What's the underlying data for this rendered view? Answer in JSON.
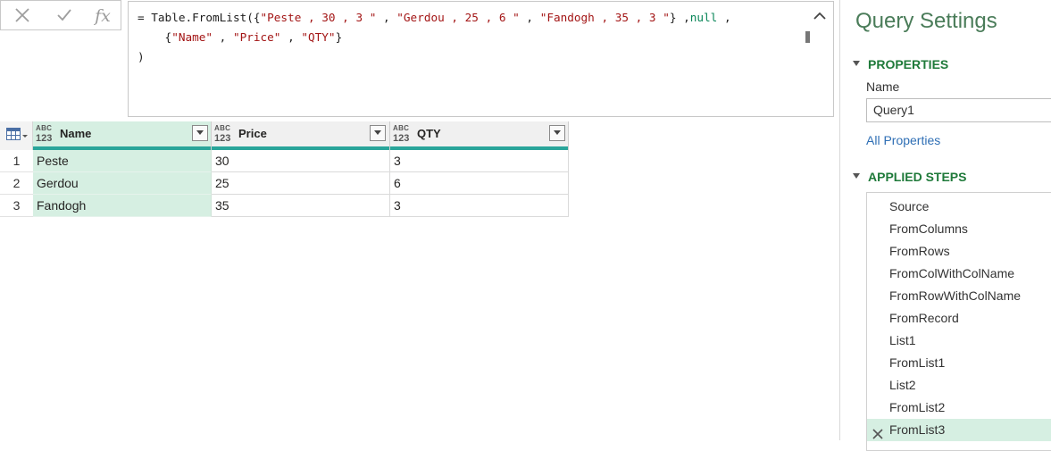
{
  "formula_bar": {
    "line1_prefix": "= Table.FromList({",
    "line1_str1": "\"Peste , 30 , 3 \"",
    "line1_comma1": " , ",
    "line1_str2": "\"Gerdou , 25 , 6 \"",
    "line1_comma2": " , ",
    "line1_str3": "\"Fandogh , 35 , 3 \"",
    "line1_close": "} ,",
    "line1_kw": "null",
    "line1_end": " ,",
    "line2_indent": "    {",
    "line2_str1": "\"Name\"",
    "line2_c1": " , ",
    "line2_str2": "\"Price\"",
    "line2_c2": " , ",
    "line2_str3": "\"QTY\"",
    "line2_end": "}",
    "line3": ")",
    "fx_label": "fx"
  },
  "grid": {
    "type_icon_text": "ABC",
    "type_icon_num": "123",
    "columns": [
      {
        "name": "Name"
      },
      {
        "name": "Price"
      },
      {
        "name": "QTY"
      }
    ],
    "rows": [
      {
        "num": "1",
        "cells": [
          "Peste",
          "30",
          "3"
        ]
      },
      {
        "num": "2",
        "cells": [
          "Gerdou",
          "25",
          "6"
        ]
      },
      {
        "num": "3",
        "cells": [
          "Fandogh",
          "35",
          "3"
        ]
      }
    ]
  },
  "settings": {
    "title": "Query Settings",
    "properties_header": "PROPERTIES",
    "name_label": "Name",
    "name_value": "Query1",
    "all_properties": "All Properties",
    "applied_steps_header": "APPLIED STEPS",
    "steps": [
      "Source",
      "FromColumns",
      "FromRows",
      "FromColWithColName",
      "FromRowWithColName",
      "FromRecord",
      "List1",
      "FromList1",
      "List2",
      "FromList2",
      "FromList3"
    ],
    "selected_step": "FromList3"
  },
  "colors": {
    "accent_green": "#1f7a3a",
    "selected_bg": "#d6efe2",
    "quality_bar": "#2aa59a",
    "link": "#2f6fb5"
  }
}
